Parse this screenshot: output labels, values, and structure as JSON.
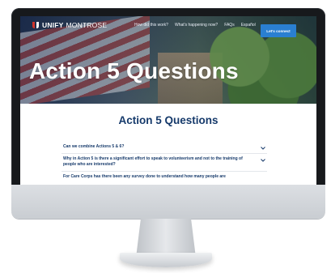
{
  "site": {
    "logo_primary": "UNIFY",
    "logo_secondary": "MONTROSE",
    "colors": {
      "accent": "#2a7fd1",
      "heading": "#163a6b",
      "logo_red": "#d0342c"
    }
  },
  "nav": {
    "links": [
      {
        "label": "How did this work?"
      },
      {
        "label": "What's happening now?"
      },
      {
        "label": "FAQs"
      },
      {
        "label": "Español"
      }
    ],
    "cta_label": "Let's connect"
  },
  "hero": {
    "title": "Action 5 Questions"
  },
  "main": {
    "section_title": "Action 5 Questions",
    "faqs": [
      {
        "question": "Can we combine Actions 5 & 6?",
        "icon": "chevron-down-icon"
      },
      {
        "question": "Why in Action 5 is there a significant effort to speak to volunteerism and not to the training of people who are interested?",
        "icon": "chevron-down-icon"
      },
      {
        "question": "For Care Corps has there been any survey done to understand how many people are",
        "icon": "chevron-down-icon"
      }
    ]
  }
}
